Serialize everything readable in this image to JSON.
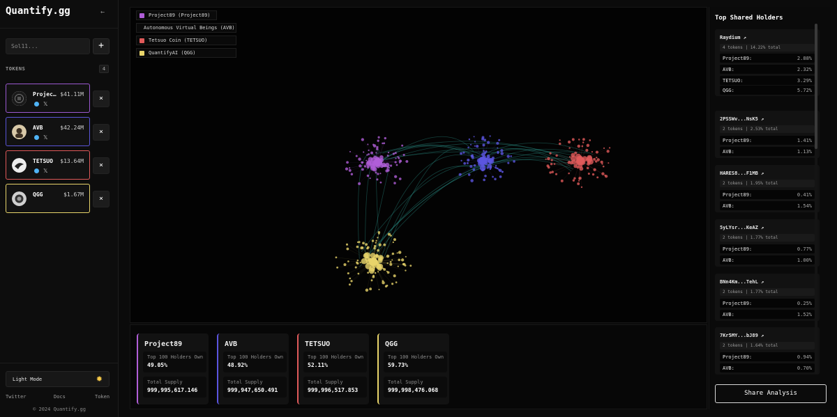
{
  "app": {
    "title": "Quantify.gg",
    "collapse_icon": "arrow-left-icon"
  },
  "sidebar": {
    "search_placeholder": "Sol11...",
    "add_label": "+",
    "tokens_label": "TOKENS",
    "tokens_count": "4",
    "tokens": [
      {
        "name": "Project89",
        "price": "$41.11M",
        "color": "#9b59d0",
        "has_website": true,
        "has_x": true
      },
      {
        "name": "AVB",
        "price": "$42.24M",
        "color": "#5a55d8",
        "has_website": true,
        "has_x": true
      },
      {
        "name": "TETSUO",
        "price": "$13.64M",
        "color": "#e05a5a",
        "has_website": true,
        "has_x": true
      },
      {
        "name": "QGG",
        "price": "$1.67M",
        "color": "#e8d46a",
        "has_website": false,
        "has_x": false
      }
    ],
    "remove_label": "×",
    "mode_label": "Light Mode",
    "mode_icon": "sun-icon",
    "footer_links": {
      "twitter": "Twitter",
      "docs": "Docs",
      "token": "Token"
    },
    "copyright": "© 2024 Quantify.gg"
  },
  "legend": [
    {
      "label": "Project89 (Project89)",
      "color": "#b05ed8"
    },
    {
      "label": "Autonomous Virtual Beings (AVB)",
      "color": "#5b55e0"
    },
    {
      "label": "Tetsuo Coin (TETSUO)",
      "color": "#e05a5a"
    },
    {
      "label": "QuantifyAI (QGG)",
      "color": "#e8d46a"
    }
  ],
  "stats": [
    {
      "title": "Project89",
      "holders_label": "Top 100 Holders Own",
      "holders_value": "49.05%",
      "supply_label": "Total Supply",
      "supply_value": "999,995,617.146",
      "color": "#b05ed8"
    },
    {
      "title": "AVB",
      "holders_label": "Top 100 Holders Own",
      "holders_value": "48.92%",
      "supply_label": "Total Supply",
      "supply_value": "999,947,650.491",
      "color": "#5b55e0"
    },
    {
      "title": "TETSUO",
      "holders_label": "Top 100 Holders Own",
      "holders_value": "52.11%",
      "supply_label": "Total Supply",
      "supply_value": "999,996,517.853",
      "color": "#e05a5a"
    },
    {
      "title": "QGG",
      "holders_label": "Top 100 Holders Own",
      "holders_value": "59.73%",
      "supply_label": "Total Supply",
      "supply_value": "999,998,476.068",
      "color": "#e8d46a"
    }
  ],
  "right_panel": {
    "title": "Top Shared Holders",
    "holders": [
      {
        "address": "Raydium ↗",
        "meta": "4 tokens | 14.22% total",
        "rows": [
          {
            "name": "Project89:",
            "pct": "2.88%"
          },
          {
            "name": "AVB:",
            "pct": "2.32%"
          },
          {
            "name": "TETSUO:",
            "pct": "3.29%"
          },
          {
            "name": "QGG:",
            "pct": "5.72%"
          }
        ]
      },
      {
        "address": "2PSSWv...NsK5 ↗",
        "meta": "2 tokens | 2.53% total",
        "rows": [
          {
            "name": "Project89:",
            "pct": "1.41%"
          },
          {
            "name": "AVB:",
            "pct": "1.13%"
          }
        ]
      },
      {
        "address": "HARES8...F1MB ↗",
        "meta": "2 tokens | 1.95% total",
        "rows": [
          {
            "name": "Project89:",
            "pct": "0.41%"
          },
          {
            "name": "AVB:",
            "pct": "1.54%"
          }
        ]
      },
      {
        "address": "5yLYsr...KeAZ ↗",
        "meta": "2 tokens | 1.77% total",
        "rows": [
          {
            "name": "Project89:",
            "pct": "0.77%"
          },
          {
            "name": "AVB:",
            "pct": "1.00%"
          }
        ]
      },
      {
        "address": "BNn4Km...TehL ↗",
        "meta": "2 tokens | 1.77% total",
        "rows": [
          {
            "name": "Project89:",
            "pct": "0.25%"
          },
          {
            "name": "AVB:",
            "pct": "1.52%"
          }
        ]
      },
      {
        "address": "7Kr5MY...bJ89 ↗",
        "meta": "2 tokens | 1.64% total",
        "rows": [
          {
            "name": "Project89:",
            "pct": "0.94%"
          },
          {
            "name": "AVB:",
            "pct": "0.70%"
          }
        ]
      }
    ],
    "share_label": "Share Analysis"
  }
}
